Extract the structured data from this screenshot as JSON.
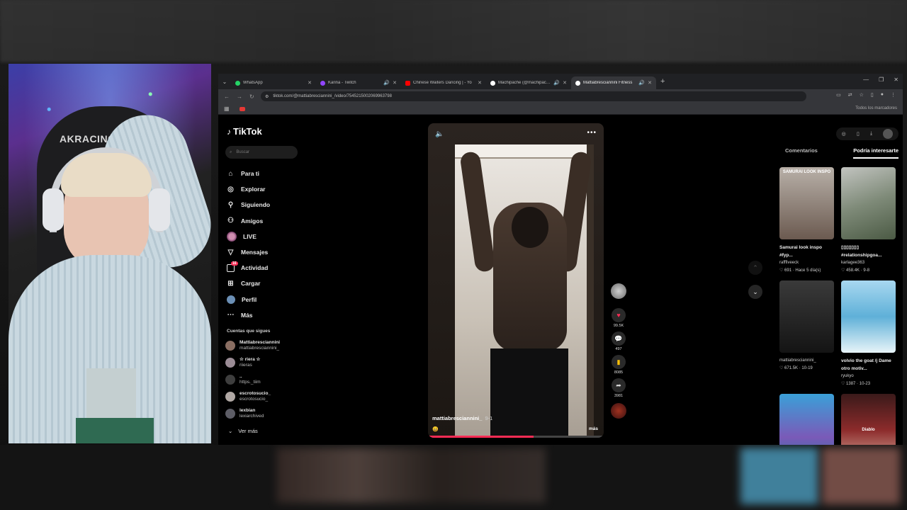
{
  "browser": {
    "tabs": [
      {
        "title": "WhatsApp",
        "favicon_color": "#25d366",
        "active": false,
        "audio": false
      },
      {
        "title": "Karina - Twitch",
        "favicon_color": "#9146ff",
        "active": false,
        "audio": true
      },
      {
        "title": "Chinese Waiters Dancing | - Yo",
        "favicon_color": "#ff0000",
        "active": false,
        "audio": false
      },
      {
        "title": "Machipache (@machipache) | ",
        "favicon_color": "#ffffff",
        "active": false,
        "audio": true
      },
      {
        "title": "Mattiabresciannini Fitness ",
        "favicon_color": "#ffffff",
        "active": true,
        "audio": true
      }
    ],
    "url": "tiktok.com/@mattiabresciannini_/video/7545215002069963798",
    "bookmarks_label": "Todos los marcadores"
  },
  "tiktok": {
    "logo_text": "TikTok",
    "search_placeholder": "Buscar",
    "nav": [
      {
        "label": "Para ti",
        "icon": "home-icon"
      },
      {
        "label": "Explorar",
        "icon": "compass-icon"
      },
      {
        "label": "Siguiendo",
        "icon": "following-icon"
      },
      {
        "label": "Amigos",
        "icon": "friends-icon"
      },
      {
        "label": "LIVE",
        "icon": "live-icon"
      },
      {
        "label": "Mensajes",
        "icon": "messages-icon"
      },
      {
        "label": "Actividad",
        "icon": "activity-icon",
        "badge": "16"
      },
      {
        "label": "Cargar",
        "icon": "upload-icon"
      },
      {
        "label": "Perfil",
        "icon": "profile-icon"
      },
      {
        "label": "Más",
        "icon": "more-icon"
      }
    ],
    "following_title": "Cuentas que sigues",
    "following": [
      {
        "name": "Mattiabresciannini",
        "handle": "mattiabresciannini_"
      },
      {
        "name": "☆ riera ☆",
        "handle": "riieras"
      },
      {
        "name": "..",
        "handle": "https._tiim"
      },
      {
        "name": "escrotosucio_",
        "handle": "escrotosucio_"
      },
      {
        "name": "lexbian",
        "handle": "lexiarchived"
      }
    ],
    "ver_mas": "Ver más",
    "video": {
      "author": "mattiabresciannini_",
      "date": "9-1",
      "emoji": "😀",
      "more_label": "más",
      "progress": 0.6
    },
    "actions": {
      "likes": "99.5K",
      "comments": "497",
      "saves": "8085",
      "shares": "3981"
    },
    "right_tabs": [
      "Comentarios",
      "Podría interesarte"
    ],
    "recommendations": [
      {
        "caption": "Samurai look inspo #fyp...",
        "user": "rafffiveeck",
        "meta": "♡ 691 · Hace 5 día(s)",
        "badge": "SAMURAI LOOK INSPO"
      },
      {
        "caption": "▯▯▯▯▯▯▯ #relationshipgoa...",
        "user": "karlagee363",
        "meta": "♡ 458.4K · 9-8",
        "badge": ""
      },
      {
        "caption": "",
        "user": "mattiabresciannini_",
        "meta": "♡ 671.5K · 10-19",
        "badge": ""
      },
      {
        "caption": "volvio the goat /j Dame otro motiv...",
        "user": "ryukyo",
        "meta": "♡ 1387 · 10-23",
        "badge": ""
      },
      {
        "caption": "",
        "user": "",
        "meta": "",
        "badge": ""
      },
      {
        "caption": "",
        "user": "",
        "meta": "",
        "badge": "Diablo"
      }
    ]
  },
  "webcam": {
    "chair_brand": "AKRACING"
  }
}
